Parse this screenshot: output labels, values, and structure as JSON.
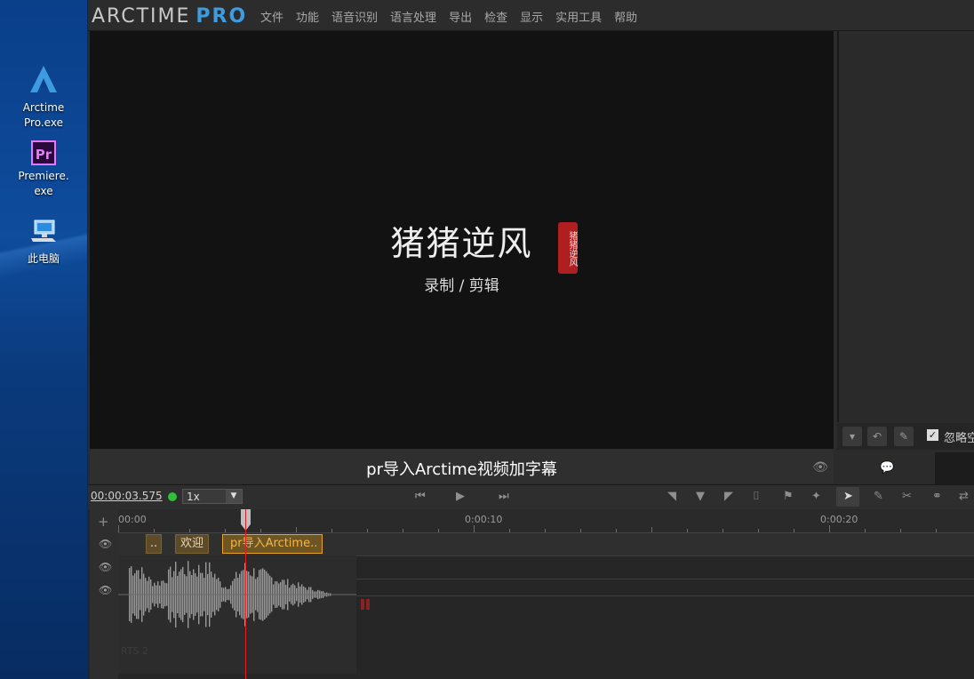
{
  "desktop": {
    "icons": [
      {
        "line1": "Arctime",
        "line2": "Pro.exe"
      },
      {
        "line1": "Premiere.",
        "line2": "exe",
        "badge": "Pr"
      },
      {
        "line1": "此电脑",
        "line2": ""
      }
    ]
  },
  "app": {
    "logo_main": "ARCTIME",
    "logo_pro": "PRO",
    "menu": [
      "文件",
      "功能",
      "语音识别",
      "语言处理",
      "导出",
      "检查",
      "显示",
      "实用工具",
      "帮助"
    ]
  },
  "preview": {
    "title": "猪猪逆风",
    "subtitle": "录制 / 剪辑",
    "seal_text": "猪猪逆风"
  },
  "subtitle_bar": {
    "text": "pr导入Arctime视频加字幕"
  },
  "right_panel": {
    "ignore_label": "忽略空"
  },
  "transport": {
    "timecode": "00:00:03.575",
    "speed": "1x"
  },
  "timeline": {
    "ruler": [
      "00:00",
      "0:00:10",
      "0:00:20"
    ],
    "clips": [
      {
        "text": ".."
      },
      {
        "text": "欢迎"
      },
      {
        "text": "pr导入Arctime.."
      }
    ],
    "track_label": "RTS 2"
  },
  "colors": {
    "accent": "#3d9be0",
    "selected_clip": "#e8a52a",
    "playhead": "#e02020"
  }
}
